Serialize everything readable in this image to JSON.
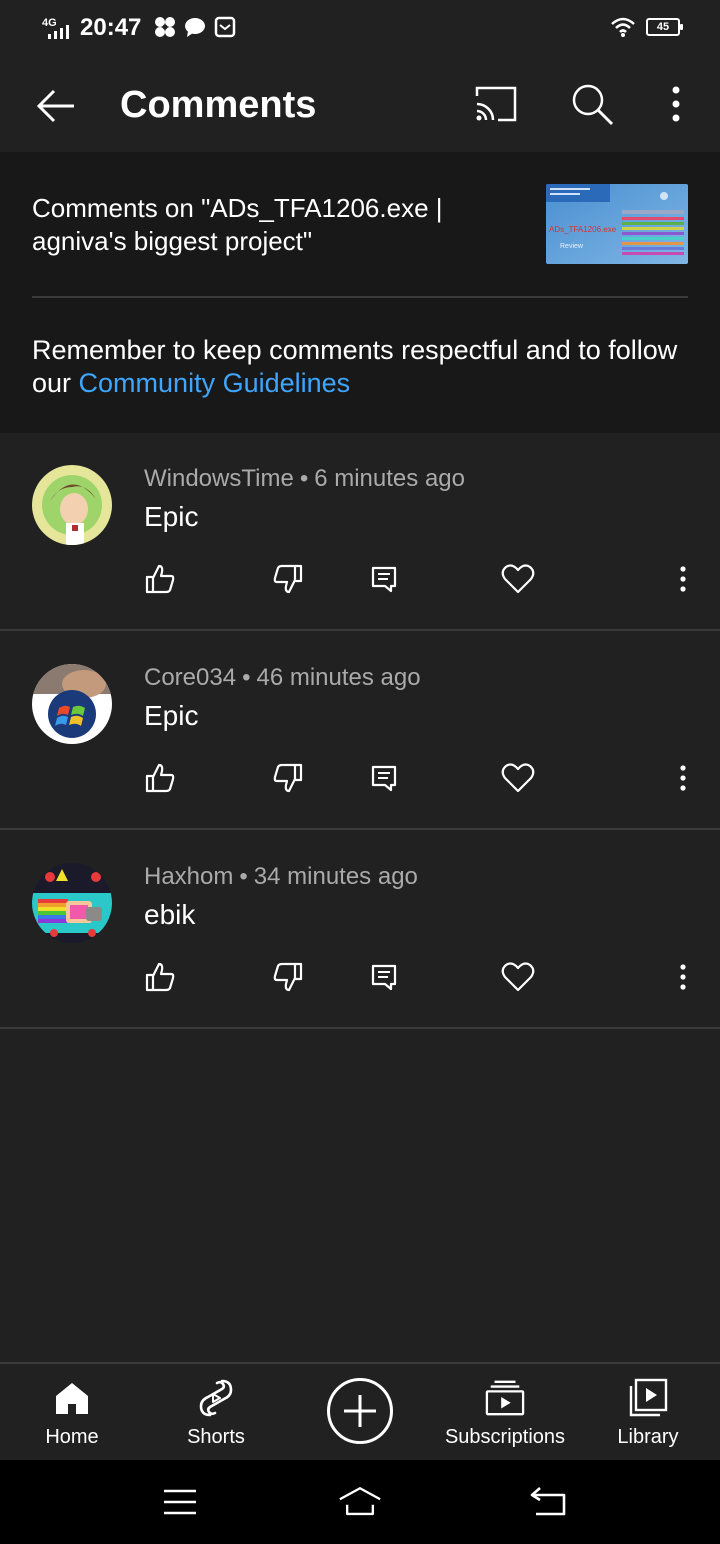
{
  "status_bar": {
    "network": "4G",
    "time": "20:47",
    "battery": "45"
  },
  "app_bar": {
    "title": "Comments"
  },
  "header": {
    "comments_on": "Comments on \"ADs_TFA1206.exe | agniva's biggest project\"",
    "thumbnail_caption": "ADs_TFA1206.exe",
    "thumbnail_sub": "Review",
    "guidelines_prefix": "Remember to keep comments respectful and to follow our",
    "guidelines_link": "Community Guidelines"
  },
  "comments": [
    {
      "author": "WindowsTime",
      "time": "6 minutes ago",
      "text": "Epic"
    },
    {
      "author": "Core034",
      "time": "46 minutes ago",
      "text": "Epic"
    },
    {
      "author": "Haxhom",
      "time": "34 minutes ago",
      "text": "ebik"
    }
  ],
  "bottom_nav": {
    "home": "Home",
    "shorts": "Shorts",
    "subscriptions": "Subscriptions",
    "library": "Library"
  },
  "colors": {
    "background": "#212121",
    "header_panel": "#181818",
    "link": "#3ea6ff",
    "secondary_text": "#aaaaaa"
  }
}
